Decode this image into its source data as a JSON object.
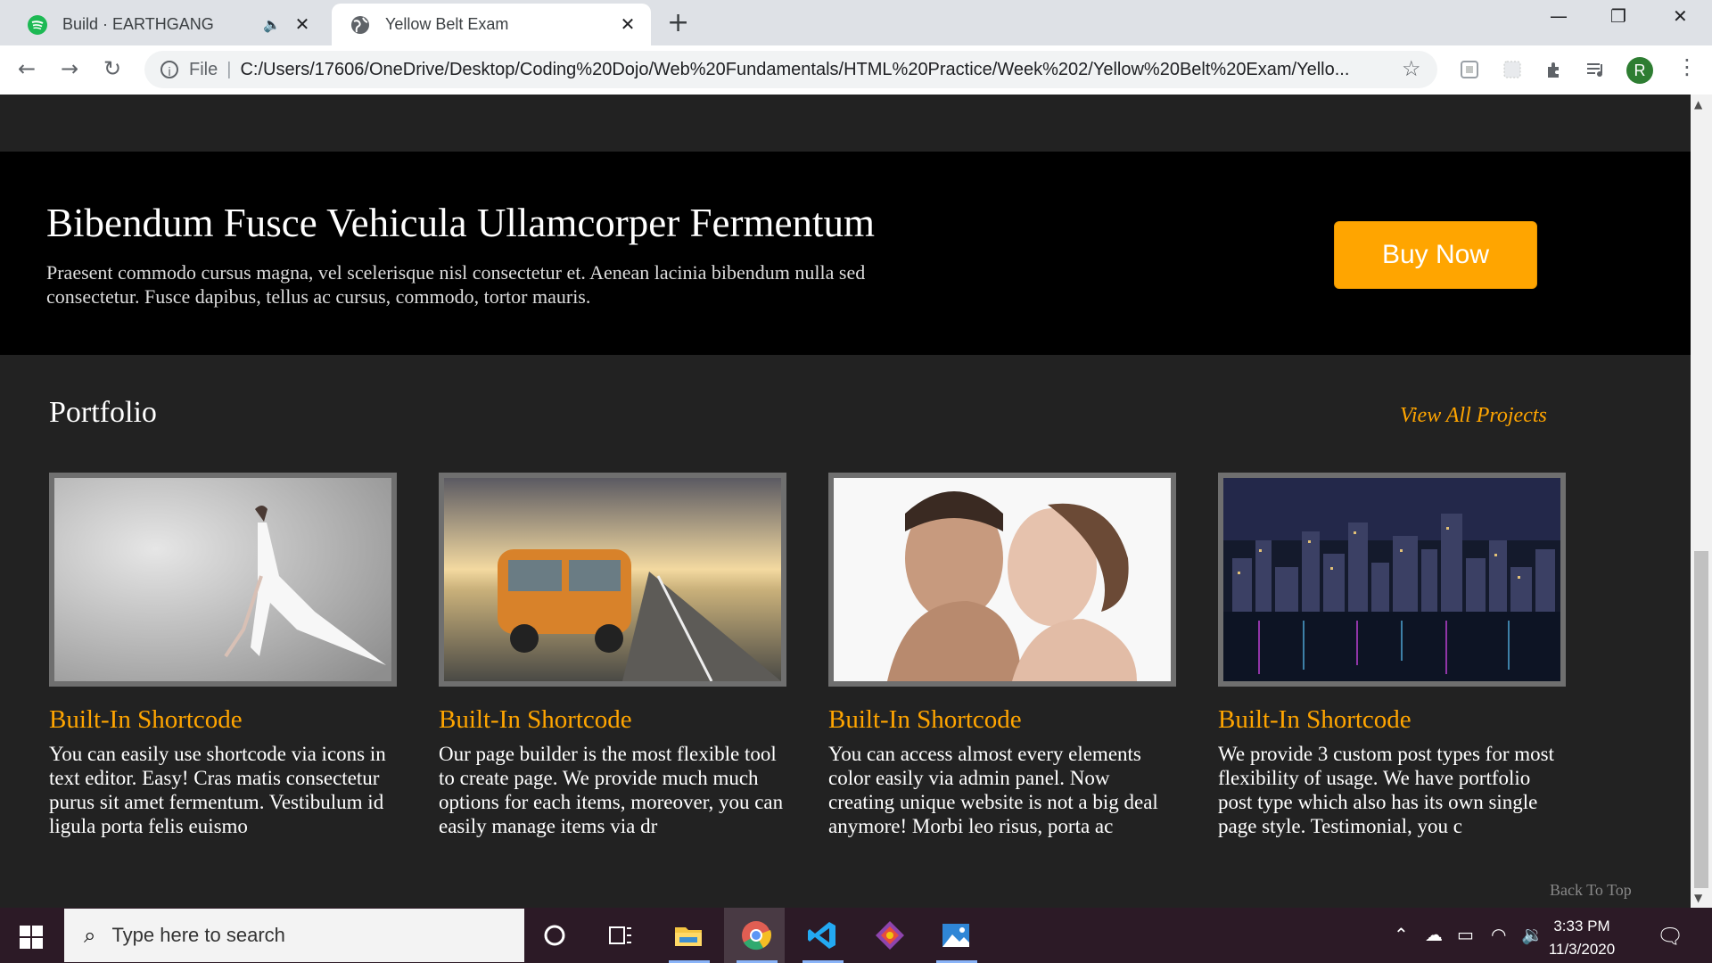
{
  "browser": {
    "tabs": [
      {
        "title": "Build · EARTHGANG",
        "favicon": "spotify-icon",
        "audio": true,
        "active": false
      },
      {
        "title": "Yellow Belt Exam",
        "favicon": "globe-icon",
        "active": true
      }
    ],
    "new_tab_symbol": "+",
    "window_controls": {
      "minimize": "—",
      "restore": "❐",
      "close": "✕"
    },
    "address": {
      "scheme_label": "File",
      "separator": "|",
      "url": "C:/Users/17606/OneDrive/Desktop/Coding%20Dojo/Web%20Fundamentals/HTML%20Practice/Week%202/Yellow%20Belt%20Exam/Yello..."
    },
    "profile_initial": "R"
  },
  "cta": {
    "title": "Bibendum Fusce Vehicula Ullamcorper Fermentum",
    "text": "Praesent commodo cursus magna, vel scelerisque nisl consectetur et. Aenean lacinia bibendum nulla sed consectetur. Fusce dapibus, tellus ac cursus, commodo, tortor mauris.",
    "button_label": "Buy Now",
    "button_color": "#ffa500"
  },
  "portfolio": {
    "title": "Portfolio",
    "view_all_label": "View All Projects",
    "accent": "#ffa500",
    "cards": [
      {
        "image": "dancer-in-white-dress",
        "title": "Built-In Shortcode",
        "text": "You can easily use shortcode via icons in text editor. Easy! Cras matis consectetur purus sit amet fermentum. Vestibulum id ligula porta felis euismo"
      },
      {
        "image": "orange-bus-on-road",
        "title": "Built-In Shortcode",
        "text": "Our page builder is the most flexible tool to create page. We provide much much options for each items, moreover, you can easily manage items via dr"
      },
      {
        "image": "couple-portrait",
        "title": "Built-In Shortcode",
        "text": "You can access almost every elements color easily via admin panel. Now creating unique website is not a big deal anymore! Morbi leo risus, porta ac"
      },
      {
        "image": "city-skyline-night",
        "title": "Built-In Shortcode",
        "text": "We provide 3 custom post types for most flexibility of usage. We have portfolio post type which also has its own single page style. Testimonial, you c"
      }
    ],
    "back_to_top": "Back To Top"
  },
  "taskbar": {
    "search_placeholder": "Type here to search",
    "pinned": [
      "cortana-icon",
      "task-view-icon",
      "file-explorer-icon",
      "chrome-icon",
      "vscode-icon",
      "git-icon",
      "photos-icon"
    ],
    "time": "3:33 PM",
    "date": "11/3/2020"
  }
}
